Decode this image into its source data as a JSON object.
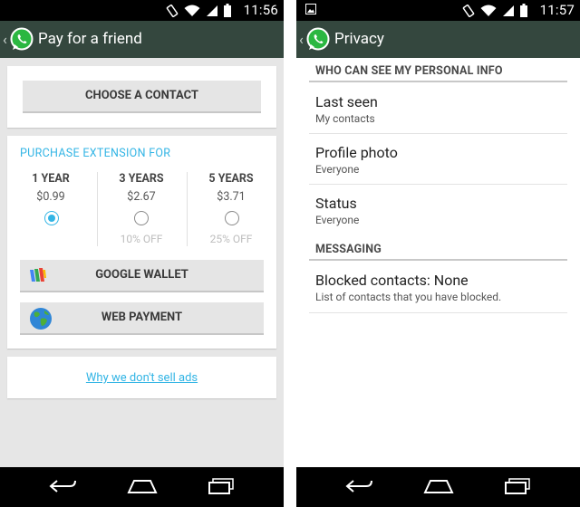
{
  "left": {
    "status_time": "11:56",
    "title": "Pay for a friend",
    "choose_contact": "CHOOSE A CONTACT",
    "purchase_title": "PURCHASE EXTENSION FOR",
    "options": [
      {
        "years": "1 YEAR",
        "price": "$0.99",
        "discount": "",
        "selected": true
      },
      {
        "years": "3 YEARS",
        "price": "$2.67",
        "discount": "10% OFF",
        "selected": false
      },
      {
        "years": "5 YEARS",
        "price": "$3.71",
        "discount": "25% OFF",
        "selected": false
      }
    ],
    "google_wallet": "GOOGLE WALLET",
    "web_payment": "WEB PAYMENT",
    "ads_link": "Why we don't sell ads"
  },
  "right": {
    "status_time": "11:57",
    "title": "Privacy",
    "section_personal": "WHO CAN SEE MY PERSONAL INFO",
    "last_seen": {
      "title": "Last seen",
      "value": "My contacts"
    },
    "profile_photo": {
      "title": "Profile photo",
      "value": "Everyone"
    },
    "status": {
      "title": "Status",
      "value": "Everyone"
    },
    "section_messaging": "MESSAGING",
    "blocked": {
      "title": "Blocked contacts: None",
      "subtitle": "List of contacts that you have blocked."
    }
  },
  "colors": {
    "actionbar": "#34473e",
    "accent": "#33b5e5",
    "whatsapp_green": "#2bb741"
  },
  "icons": [
    "whatsapp-logo-icon",
    "screen-rotation-icon",
    "wifi-icon",
    "signal-icon",
    "battery-icon",
    "image-notification-icon",
    "back-nav-icon",
    "home-nav-icon",
    "recents-nav-icon",
    "google-wallet-icon",
    "globe-icon"
  ]
}
